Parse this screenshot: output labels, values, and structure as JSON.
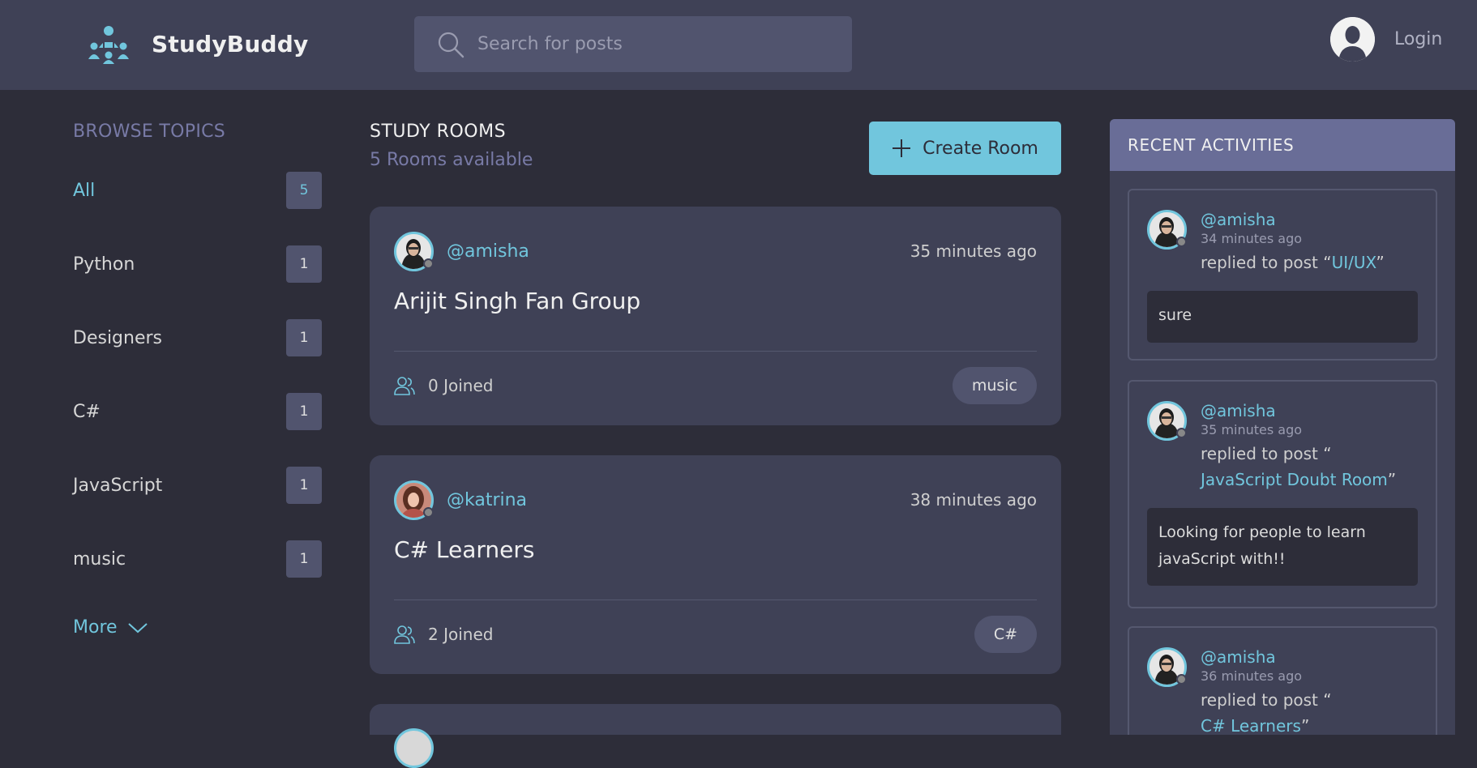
{
  "app": {
    "name": "StudyBuddy"
  },
  "search": {
    "placeholder": "Search for posts"
  },
  "user": {
    "login_label": "Login"
  },
  "topics": {
    "title": "BROWSE TOPICS",
    "items": [
      {
        "label": "All",
        "count": "5"
      },
      {
        "label": "Python",
        "count": "1"
      },
      {
        "label": "Designers",
        "count": "1"
      },
      {
        "label": "C#",
        "count": "1"
      },
      {
        "label": "JavaScript",
        "count": "1"
      },
      {
        "label": "music",
        "count": "1"
      }
    ],
    "more_label": "More"
  },
  "rooms": {
    "title": "STUDY ROOMS",
    "subtitle": "5 Rooms available",
    "create_label": "Create Room",
    "items": [
      {
        "host": "@amisha",
        "time": "35 minutes ago",
        "name": "Arijit Singh Fan Group",
        "joined": "0 Joined",
        "topic": "music"
      },
      {
        "host": "@katrina",
        "time": "38 minutes ago",
        "name": "C# Learners",
        "joined": "2 Joined",
        "topic": "C#"
      }
    ]
  },
  "activities": {
    "title": "RECENT ACTIVITIES",
    "items": [
      {
        "user": "@amisha",
        "time": "34 minutes ago",
        "action": "replied to post “",
        "post": "UI/UX",
        "close": "”",
        "message": "sure"
      },
      {
        "user": "@amisha",
        "time": "35 minutes ago",
        "action": "replied to post “",
        "post": "JavaScript Doubt Room",
        "close": "”",
        "message": "Looking for people to learn javaScript with!!"
      },
      {
        "user": "@amisha",
        "time": "36 minutes ago",
        "action": "replied to post “",
        "post": "C# Learners",
        "close": "”"
      }
    ]
  },
  "colors": {
    "accent": "#71c6dd",
    "header_bg": "#3f4156",
    "page_bg": "#2d2d39",
    "activity_header": "#696d97"
  }
}
